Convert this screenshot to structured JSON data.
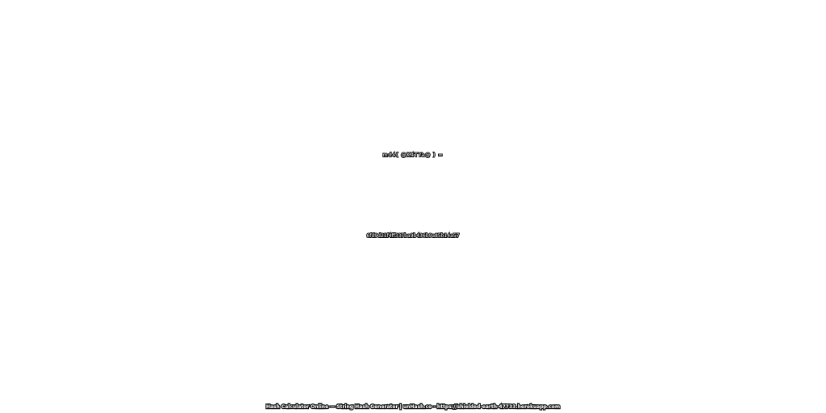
{
  "hash": {
    "expression": "md4( @K4TYa@ ) =",
    "value": "6fd9d21f4ff337ba9b436b9a85b14a57"
  },
  "footer": {
    "text": "Hash Calculator Online — String Hash Generator | unHash.co - https://shielded-earth-47733.herokuapp.com"
  },
  "colors": {
    "background": "#ffffff",
    "outline": "#111111",
    "fill": "#ffffff"
  }
}
